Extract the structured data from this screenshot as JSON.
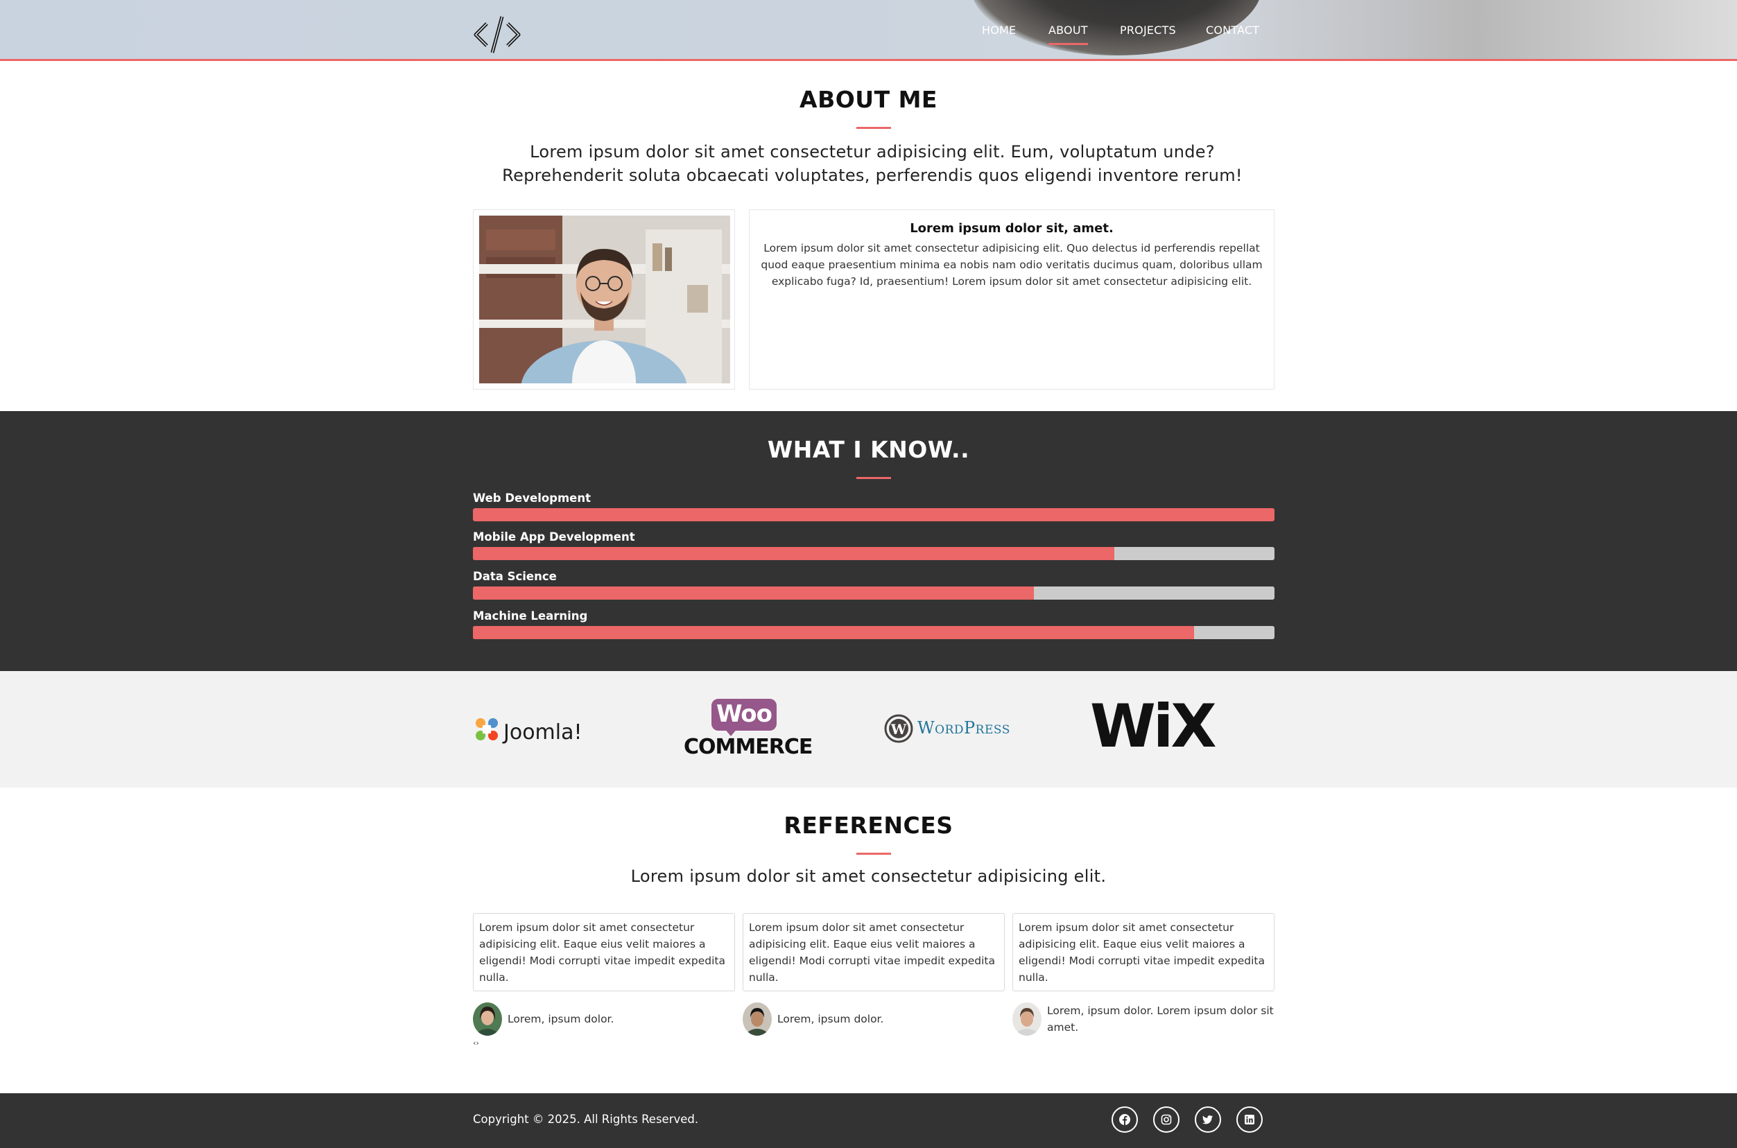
{
  "nav": {
    "items": [
      {
        "label": "HOME",
        "active": false
      },
      {
        "label": "ABOUT",
        "active": true
      },
      {
        "label": "PROJECTS",
        "active": false
      },
      {
        "label": "CONTACT",
        "active": false
      }
    ]
  },
  "logo_icon": "code-brackets-icon",
  "about": {
    "title": "ABOUT ME",
    "lead": "Lorem ipsum dolor sit amet consectetur adipisicing elit. Eum, voluptatum unde? Reprehenderit soluta obcaecati voluptates, perferendis quos eligendi inventore rerum!",
    "card_title": "Lorem ipsum dolor sit, amet.",
    "card_text": "Lorem ipsum dolor sit amet consectetur adipisicing elit. Quo delectus id perferendis repellat quod eaque praesentium minima ea nobis nam odio veritatis ducimus quam, doloribus ullam explicabo fuga? Id, praesentium! Lorem ipsum dolor sit amet consectetur adipisicing elit."
  },
  "skills": {
    "title": "WHAT I KNOW..",
    "items": [
      {
        "label": "Web Development",
        "level": 100
      },
      {
        "label": "Mobile App Development",
        "level": 80
      },
      {
        "label": "Data Science",
        "level": 70
      },
      {
        "label": "Machine Learning",
        "level": 90
      }
    ]
  },
  "brands": {
    "joomla": "Joomla!",
    "woo_top": "Woo",
    "woo_bottom": "COMMERCE",
    "wordpress": "WordPress",
    "wix": "WiX"
  },
  "references": {
    "title": "REFERENCES",
    "lead": "Lorem ipsum dolor sit amet consectetur adipisicing elit.",
    "items": [
      {
        "text": "Lorem ipsum dolor sit amet consectetur adipisicing elit. Eaque eius velit maiores a eligendi! Modi corrupti vitae impedit expedita nulla.",
        "name": "Lorem, ipsum dolor."
      },
      {
        "text": "Lorem ipsum dolor sit amet consectetur adipisicing elit. Eaque eius velit maiores a eligendi! Modi corrupti vitae impedit expedita nulla.",
        "name": "Lorem, ipsum dolor."
      },
      {
        "text": "Lorem ipsum dolor sit amet consectetur adipisicing elit. Eaque eius velit maiores a eligendi! Modi corrupti vitae impedit expedita nulla.",
        "name": "Lorem, ipsum dolor. Lorem ipsum dolor sit amet."
      }
    ],
    "stray_glyph": "‹›"
  },
  "footer": {
    "copyright": "Copyright © 2025. All Rights Reserved.",
    "social": [
      "facebook-icon",
      "instagram-icon",
      "twitter-icon",
      "linkedin-icon"
    ]
  },
  "colors": {
    "accent": "#ec6767",
    "dark": "#333333",
    "light_bg": "#f2f2f2",
    "bar_bg": "#cbcbcb"
  }
}
